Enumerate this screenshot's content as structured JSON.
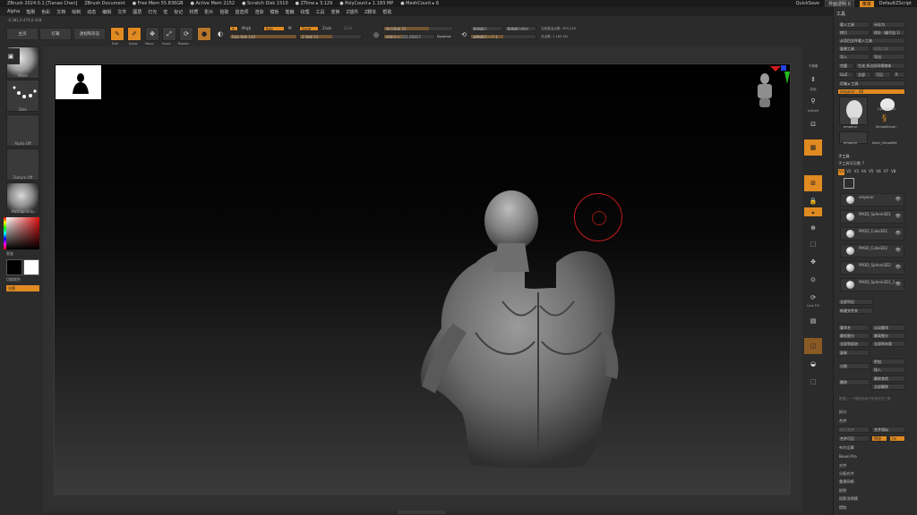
{
  "titlebar": {
    "app": "ZBrush 2024.0.1 [Tianao Chen]",
    "doc": "ZBrush Document",
    "free_mem": "● Free Mem 55.836GB",
    "active_mem": "● Active Mem 2152",
    "scratch": "● Scratch Disk 1510",
    "ztime": "● ZTime ▸ 3.129",
    "polycount": "● PolyCount ▸ 1.183 MP",
    "meshcount": "● MeshCount ▸ 6",
    "quicksave": "QuickSave",
    "transparency": "界面透明 0",
    "menus_btn": "菜单",
    "script": "DefaultZScript"
  },
  "menubar": [
    "Alpha",
    "笔刷",
    "色彩",
    "文档",
    "绘制",
    "动态",
    "编辑",
    "文件",
    "图层",
    "灯光",
    "宏",
    "标记",
    "材质",
    "影片",
    "拾取",
    "首选项",
    "渲染",
    "模板",
    "笔触",
    "纹理",
    "工具",
    "变换",
    "Z插件",
    "Z脚本",
    "帮助"
  ],
  "coords": "-0.381,0.479,0.428",
  "shelf": {
    "home": "主页",
    "lightbox": "灯箱",
    "perspective": "透视和形态",
    "edit": "Edit",
    "draw": "Draw",
    "move": "Move",
    "scale": "Scale",
    "rotate": "Rotate",
    "a_btn": "A",
    "mrgb": "Mrgb",
    "rgb": "Rgb",
    "m": "M",
    "zadd": "Zadd",
    "zsub": "Zsub",
    "zcut": "Zcut",
    "rgb_intensity": "Rgb 强度 100",
    "z_intensity": "Z 强度 53",
    "focal_shift": "焦点衰减 33",
    "draw_size": "绘制大小 351.05917",
    "dynamic": "Dynamic",
    "replay_last": "重播最后",
    "replay_last_rel": "重播最后相对",
    "adjust_last": "调整最后一个 1",
    "active_points": "当前激活点数: 393,218",
    "total_points": "总点数: 1.183 Mil"
  },
  "left": {
    "brush": "Move",
    "stroke": "Dots",
    "alpha": "Alpha Off",
    "texture": "Texture Off",
    "material": "MatCap Gray",
    "gradient": "渐变",
    "switch_color": "切换颜色",
    "alternate": "交替"
  },
  "right_shelf": [
    "子像素",
    "实际",
    "AAHalf",
    "动态",
    "透视",
    "地面网格",
    "框选",
    "透明",
    "Line Fill",
    "PolyF"
  ],
  "tool_panel": {
    "header": "工具",
    "load": "载入工具",
    "save": "另存为",
    "copy": "拷贝",
    "paste": "保存（编号加 1）",
    "from_file": "从项目文件载入工具",
    "copy_tool": "复制工具",
    "paste_tool": "粘贴工具",
    "import": "导入",
    "export": "导出",
    "clone": "克隆",
    "make_poly": "生成 多边形网格物体",
    "goz": "GoZ",
    "all": "全部",
    "visible": "可见",
    "r": "R",
    "lightbox_tools": "灯箱 ▸ 工具",
    "emperor_slider": "emperor . 48",
    "tools": [
      "emperor",
      "Cylinder3D",
      "SimpleBrush",
      "emperor",
      "Nicki_VirtualMe"
    ],
    "subtool_header": "子工具",
    "subtool_count": "子工具可见数 7",
    "subtool_tabs": [
      "V1",
      "V2",
      "V3",
      "V4",
      "V5",
      "V6",
      "V7",
      "V8"
    ],
    "subtools": [
      "emperor",
      "PM3D_Sphere3D1",
      "PM3D_Cube3D1",
      "PM3D_Cube3D2",
      "PM3D_Sphere3D2",
      "PM3D_Sphere3D1_1"
    ],
    "list_all": "全部列出",
    "new_folder": "新建文件夹",
    "rename": "重命名",
    "auto_reorder": "自动重排",
    "all_low": "最低细分",
    "all_high": "最高细分",
    "all_to_start": "全部到起始",
    "all_to_end": "全部到末尾",
    "duplicate": "复制",
    "append": "附加",
    "insert": "插入",
    "split": "分割",
    "merge": "合并",
    "delete": "删除",
    "del_other": "删除其他",
    "del_all": "全部删除",
    "hint": "根据上一个操作选择子所有的子工具",
    "split2": "拆分",
    "merge2": "合并",
    "merge_down": "向下合并",
    "merge_similar": "合并相似",
    "merge_visible": "合并可见",
    "weld": "焊接",
    "uv": "Uv",
    "boolean": "布尔运算",
    "bevel_pro": "Bevel Pro",
    "align": "对齐",
    "distribute": "分配对齐",
    "remesh": "重建网格",
    "project": "投射",
    "project_bp": "投影浇铸模",
    "extract": "提取"
  }
}
